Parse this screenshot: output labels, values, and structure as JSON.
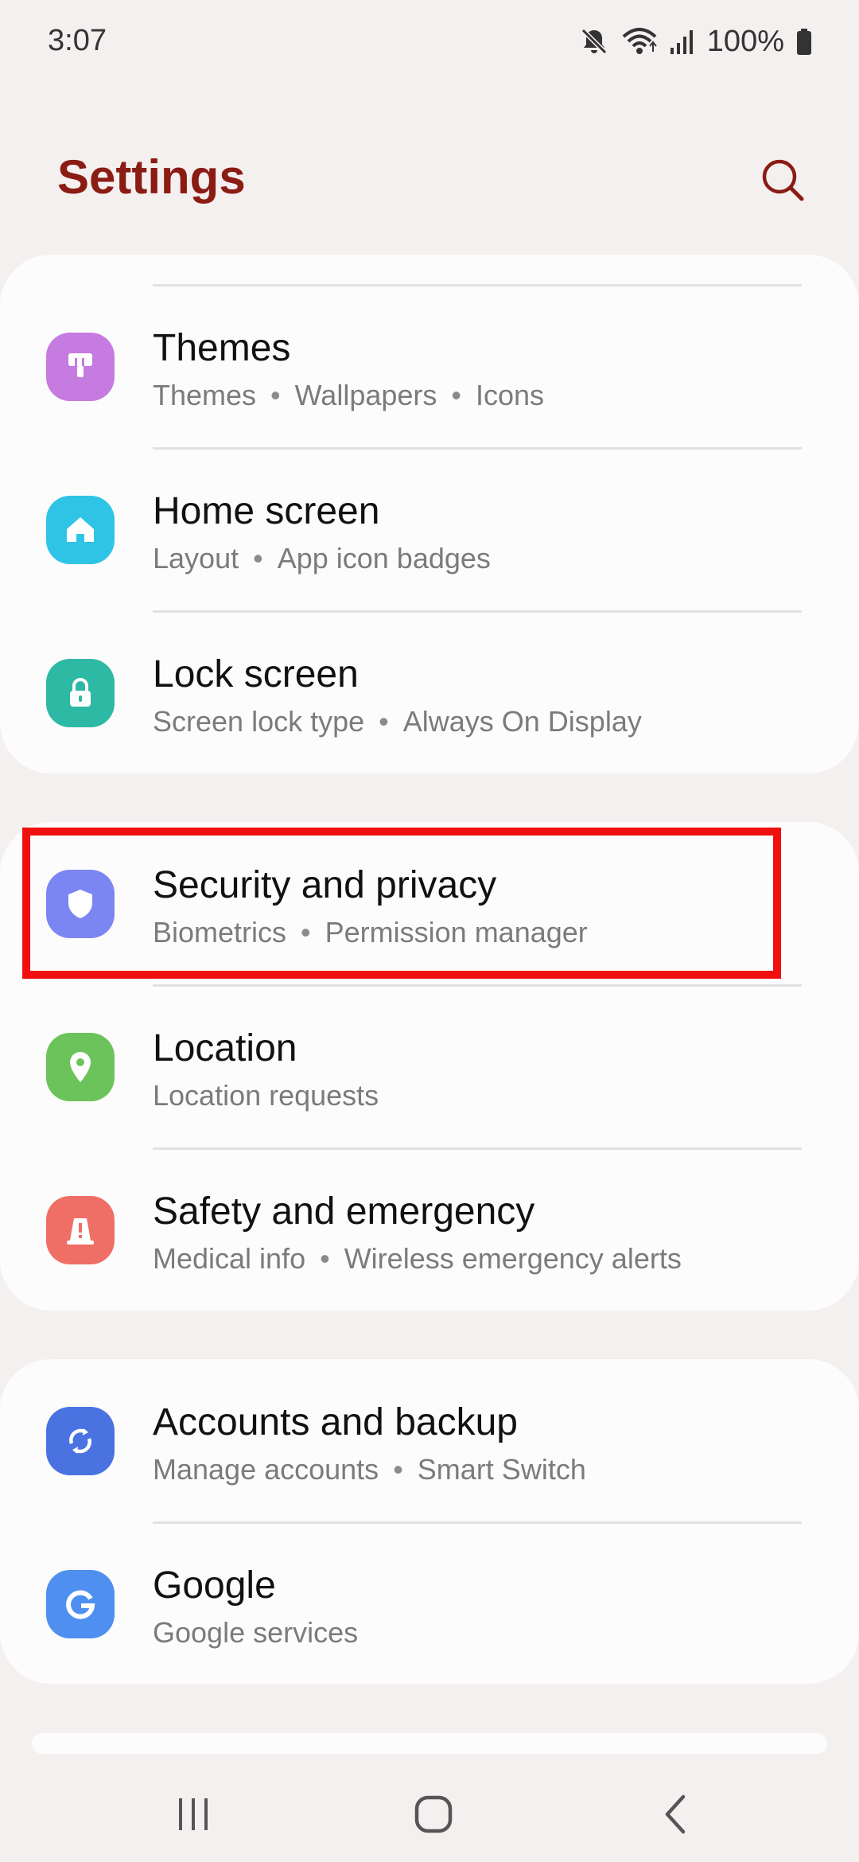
{
  "status": {
    "time": "3:07",
    "battery": "100%",
    "icons": [
      "mute-icon",
      "wifi-icon",
      "signal-icon",
      "battery-icon"
    ]
  },
  "header": {
    "title": "Settings",
    "search_icon": "search-icon"
  },
  "colors": {
    "title": "#8a1c14",
    "highlight": "#f01010",
    "themes": "#c67be0",
    "home": "#2fc4e6",
    "lock": "#2db9a3",
    "security": "#7b86f2",
    "location": "#6cc35c",
    "safety": "#ef6f66",
    "accounts": "#4a72e0",
    "google": "#4f8ff0"
  },
  "items": [
    {
      "title": "Themes",
      "sub1": "Themes",
      "sub2": "Wallpapers",
      "sub3": "Icons",
      "icon": "brush-icon"
    },
    {
      "title": "Home screen",
      "sub1": "Layout",
      "sub2": "App icon badges",
      "icon": "home-icon"
    },
    {
      "title": "Lock screen",
      "sub1": "Screen lock type",
      "sub2": "Always On Display",
      "icon": "lock-icon"
    },
    {
      "title": "Security and privacy",
      "sub1": "Biometrics",
      "sub2": "Permission manager",
      "icon": "shield-icon"
    },
    {
      "title": "Location",
      "sub1": "Location requests",
      "icon": "location-pin-icon"
    },
    {
      "title": "Safety and emergency",
      "sub1": "Medical info",
      "sub2": "Wireless emergency alerts",
      "icon": "emergency-icon"
    },
    {
      "title": "Accounts and backup",
      "sub1": "Manage accounts",
      "sub2": "Smart Switch",
      "icon": "sync-icon"
    },
    {
      "title": "Google",
      "sub1": "Google services",
      "icon": "google-icon"
    }
  ],
  "nav": {
    "recents_icon": "recents-icon",
    "home_icon": "home-button-icon",
    "back_icon": "back-icon"
  }
}
